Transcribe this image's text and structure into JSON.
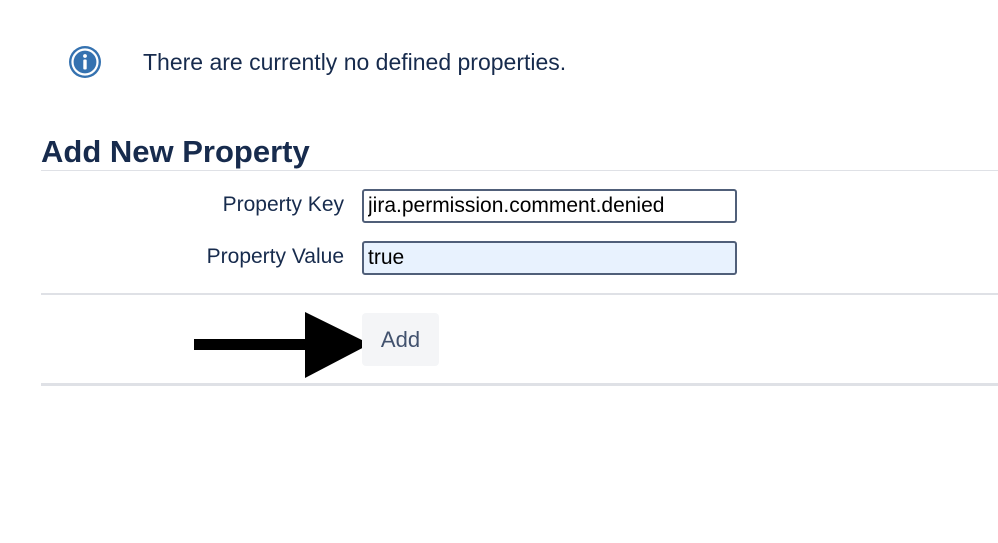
{
  "info": {
    "icon": "info-icon",
    "icon_color": "#3572b0",
    "message": "There are currently no defined properties."
  },
  "add_property": {
    "title": "Add New Property",
    "key_label": "Property Key",
    "key_value": "jira.permission.comment.denied",
    "value_label": "Property Value",
    "value_value": "true",
    "submit_label": "Add"
  },
  "annotation": {
    "icon": "arrow-right-icon",
    "color": "#000000"
  }
}
